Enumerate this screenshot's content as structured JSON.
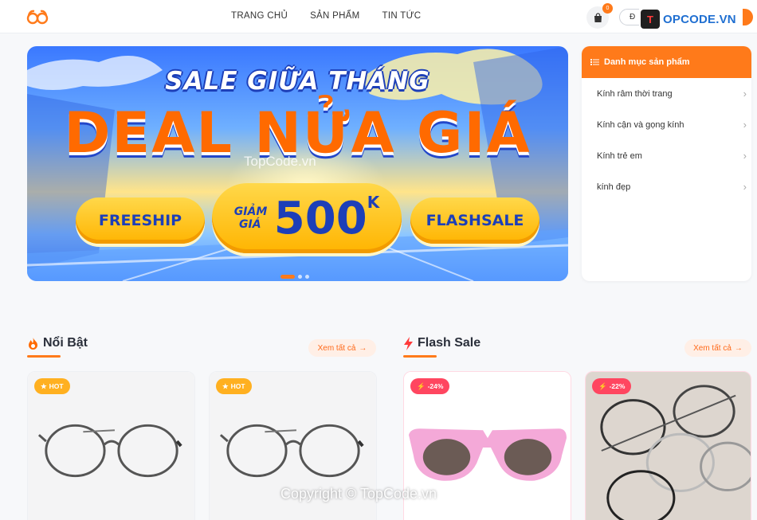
{
  "nav": [
    "TRANG CHỦ",
    "SẢN PHẨM",
    "TIN TỨC"
  ],
  "cart_count": "0",
  "login_label": "Đ",
  "watermark_top": {
    "prefix": "T",
    "rest": "OPCODE.VN"
  },
  "banner": {
    "headline": "SALE GIỮA THÁNG",
    "deal": "DEAL NỬA GIÁ",
    "freeship": "FREESHIP",
    "discount_word": "GIẢM GIÁ",
    "discount_amount": "500",
    "discount_unit": "K",
    "flashsale": "FLASHSALE",
    "watermark": "TopCode.vn"
  },
  "category": {
    "title": "Danh mục sản phẩm",
    "items": [
      "Kính râm thời trang",
      "Kính cận và gọng kính",
      "Kính trẻ em",
      "kính đẹp"
    ]
  },
  "featured": {
    "title": "Nổi Bật",
    "see_all": "Xem tất cả",
    "products": [
      {
        "tag": "HOT"
      },
      {
        "tag": "HOT"
      }
    ]
  },
  "flash": {
    "title": "Flash Sale",
    "see_all": "Xem tất cả",
    "products": [
      {
        "tag": "-24%"
      },
      {
        "tag": "-22%"
      }
    ]
  },
  "watermark_bottom": "Copyright © TopCode.vn",
  "colors": {
    "accent": "#ff7a1a",
    "hot": "#ffb020",
    "discount": "#ff4660"
  }
}
